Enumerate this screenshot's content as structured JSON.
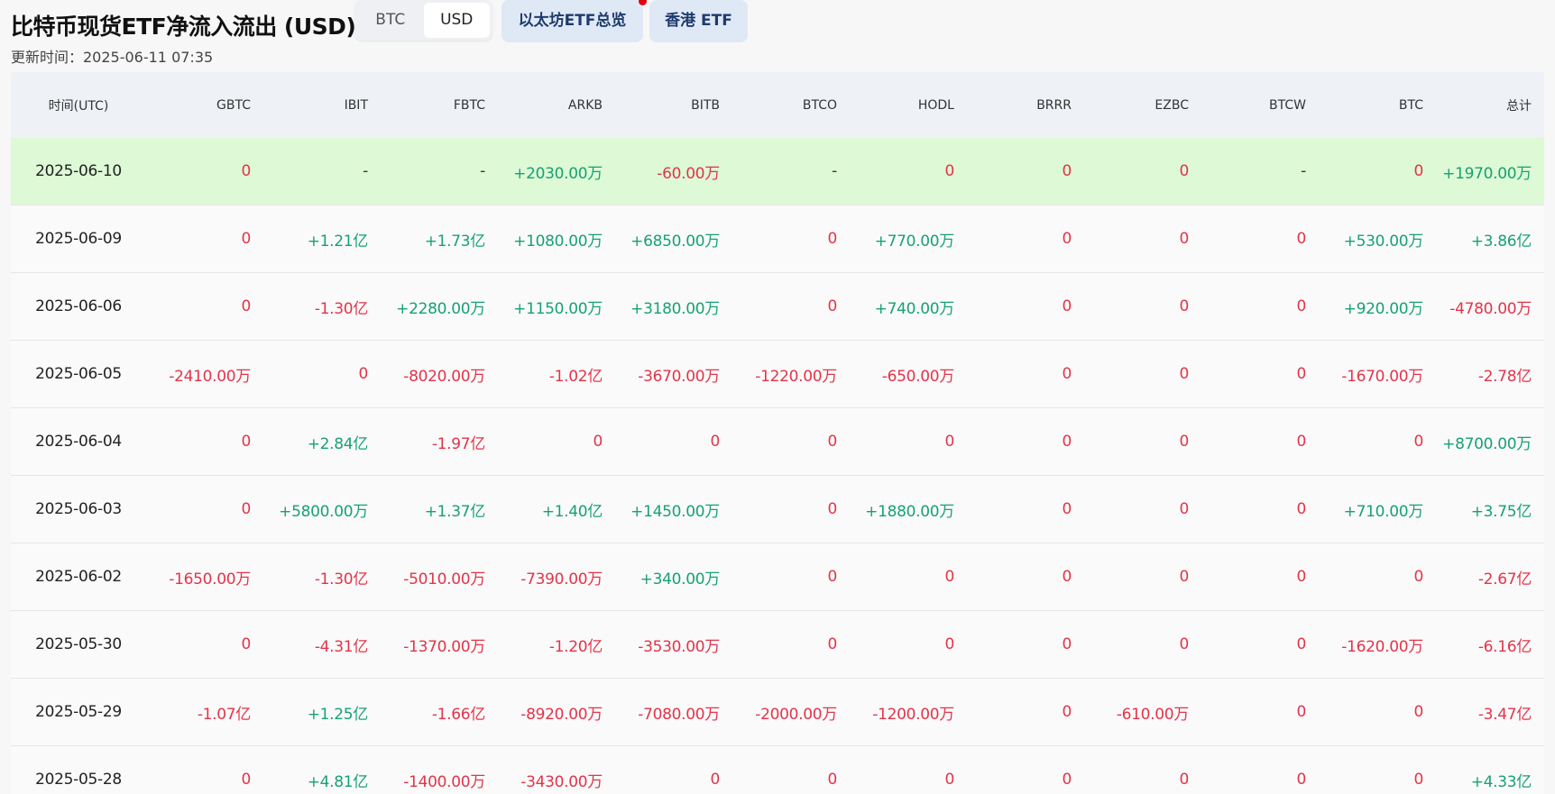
{
  "header": {
    "title": "比特币现货ETF净流入流出 (USD)",
    "updated": "更新时间：2025-06-11 07:35"
  },
  "unit_toggle": {
    "options": [
      "BTC",
      "USD"
    ],
    "selected": "USD"
  },
  "links": {
    "eth_overview": "以太坊ETF总览",
    "hk_etf": "香港 ETF"
  },
  "colors": {
    "positive": "#17a173",
    "negative": "#e3344a",
    "highlight_row": "#ddf9d5",
    "header_bg": "#eef2f6"
  },
  "table": {
    "columns": [
      "时间(UTC)",
      "GBTC",
      "IBIT",
      "FBTC",
      "ARKB",
      "BITB",
      "BTCO",
      "HODL",
      "BRRR",
      "EZBC",
      "BTCW",
      "BTC",
      "总计"
    ],
    "rows": [
      [
        "2025-06-10",
        "0",
        "-",
        "-",
        "+2030.00万",
        "-60.00万",
        "-",
        "0",
        "0",
        "0",
        "-",
        "0",
        "+1970.00万"
      ],
      [
        "2025-06-09",
        "0",
        "+1.21亿",
        "+1.73亿",
        "+1080.00万",
        "+6850.00万",
        "0",
        "+770.00万",
        "0",
        "0",
        "0",
        "+530.00万",
        "+3.86亿"
      ],
      [
        "2025-06-06",
        "0",
        "-1.30亿",
        "+2280.00万",
        "+1150.00万",
        "+3180.00万",
        "0",
        "+740.00万",
        "0",
        "0",
        "0",
        "+920.00万",
        "-4780.00万"
      ],
      [
        "2025-06-05",
        "-2410.00万",
        "0",
        "-8020.00万",
        "-1.02亿",
        "-3670.00万",
        "-1220.00万",
        "-650.00万",
        "0",
        "0",
        "0",
        "-1670.00万",
        "-2.78亿"
      ],
      [
        "2025-06-04",
        "0",
        "+2.84亿",
        "-1.97亿",
        "0",
        "0",
        "0",
        "0",
        "0",
        "0",
        "0",
        "0",
        "+8700.00万"
      ],
      [
        "2025-06-03",
        "0",
        "+5800.00万",
        "+1.37亿",
        "+1.40亿",
        "+1450.00万",
        "0",
        "+1880.00万",
        "0",
        "0",
        "0",
        "+710.00万",
        "+3.75亿"
      ],
      [
        "2025-06-02",
        "-1650.00万",
        "-1.30亿",
        "-5010.00万",
        "-7390.00万",
        "+340.00万",
        "0",
        "0",
        "0",
        "0",
        "0",
        "0",
        "-2.67亿"
      ],
      [
        "2025-05-30",
        "0",
        "-4.31亿",
        "-1370.00万",
        "-1.20亿",
        "-3530.00万",
        "0",
        "0",
        "0",
        "0",
        "0",
        "-1620.00万",
        "-6.16亿"
      ],
      [
        "2025-05-29",
        "-1.07亿",
        "+1.25亿",
        "-1.66亿",
        "-8920.00万",
        "-7080.00万",
        "-2000.00万",
        "-1200.00万",
        "0",
        "-610.00万",
        "0",
        "0",
        "-3.47亿"
      ],
      [
        "2025-05-28",
        "0",
        "+4.81亿",
        "-1400.00万",
        "-3430.00万",
        "0",
        "0",
        "0",
        "0",
        "0",
        "0",
        "0",
        "+4.33亿"
      ]
    ],
    "highlighted_row": "2025-06-10"
  }
}
